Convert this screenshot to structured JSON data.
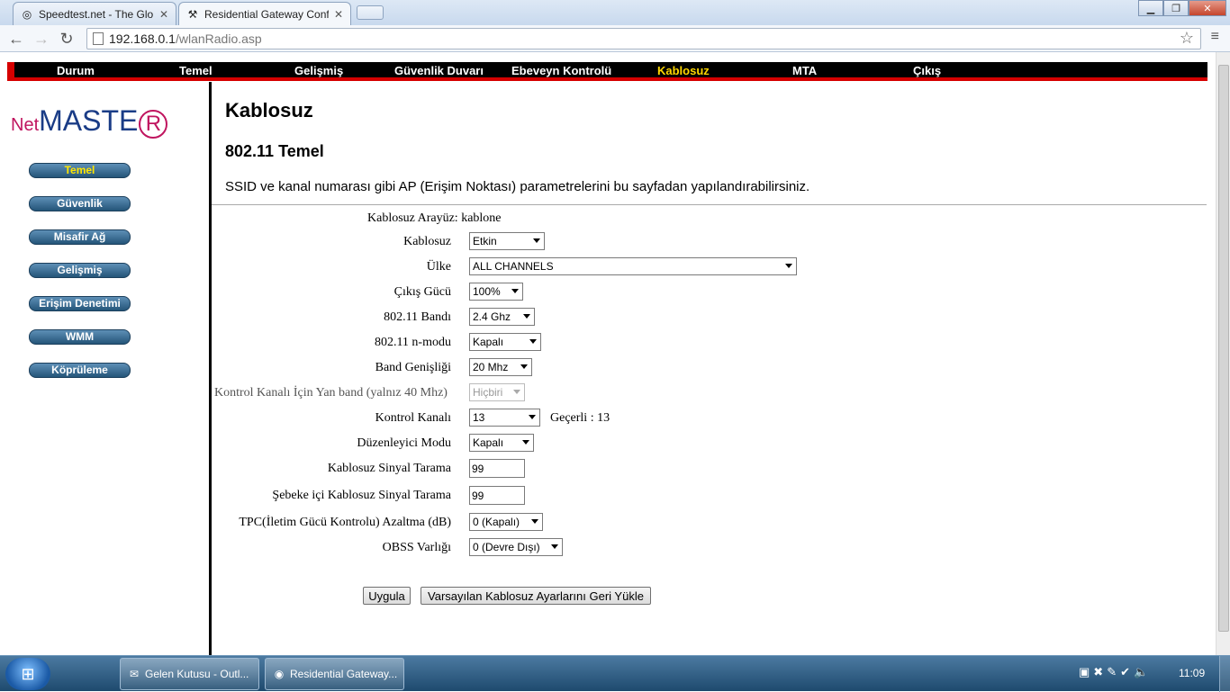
{
  "browser": {
    "tabs": [
      {
        "title": "Speedtest.net - The Global",
        "icon": "speedtest-icon"
      },
      {
        "title": "Residential Gateway Config",
        "icon": "tools-icon"
      }
    ],
    "address": {
      "host": "192.168.0.1",
      "path": "/wlanRadio.asp"
    }
  },
  "topnav": {
    "items": [
      "Durum",
      "Temel",
      "Gelişmiş",
      "Güvenlik Duvarı",
      "Ebeveyn Kontrolü",
      "Kablosuz",
      "MTA",
      "Çıkış"
    ],
    "active": "Kablosuz"
  },
  "logo": {
    "prefix": "Net",
    "main": "MASTE",
    "circled": "R"
  },
  "sidebar": {
    "items": [
      "Temel",
      "Güvenlik",
      "Misafir Ağ",
      "Gelişmiş",
      "Erişim Denetimi",
      "WMM",
      "Köprüleme"
    ],
    "active": "Temel"
  },
  "page": {
    "title": "Kablosuz",
    "section": "802.11 Temel",
    "description": "SSID ve kanal numarası gibi AP (Erişim Noktası) parametrelerini bu sayfadan yapılandırabilirsiniz."
  },
  "form": {
    "interface_label": "Kablosuz Arayüz:",
    "interface_value": "kablone",
    "wireless": {
      "label": "Kablosuz",
      "value": "Etkin"
    },
    "country": {
      "label": "Ülke",
      "value": "ALL CHANNELS"
    },
    "output_power": {
      "label": "Çıkış Gücü",
      "value": "100%"
    },
    "band": {
      "label": "802.11 Bandı",
      "value": "2.4 Ghz"
    },
    "n_mode": {
      "label": "802.11 n-modu",
      "value": "Kapalı"
    },
    "bandwidth": {
      "label": "Band Genişliği",
      "value": "20 Mhz"
    },
    "sideband": {
      "label": "Kontrol Kanalı İçin Yan band (yalnız 40 Mhz)",
      "value": "Hiçbiri"
    },
    "control_channel": {
      "label": "Kontrol Kanalı",
      "value": "13",
      "current": "Geçerli : 13"
    },
    "regulatory_mode": {
      "label": "Düzenleyici Modu",
      "value": "Kapalı"
    },
    "scan": {
      "label": "Kablosuz Sinyal Tarama",
      "value": "99"
    },
    "inband_scan": {
      "label": "Şebeke içi Kablosuz Sinyal Tarama",
      "value": "99"
    },
    "tpc": {
      "label": "TPC(İletim Gücü Kontrolu) Azaltma (dB)",
      "value": "0 (Kapalı)"
    },
    "obss": {
      "label": "OBSS Varlığı",
      "value": "0 (Devre Dışı)"
    },
    "apply_button": "Uygula",
    "restore_button": "Varsayılan Kablosuz Ayarlarını Geri Yükle"
  },
  "taskbar": {
    "items": [
      {
        "title": "Gelen Kutusu - Outl...",
        "icon": "outlook-icon"
      },
      {
        "title": "Residential Gateway...",
        "icon": "chrome-icon"
      }
    ],
    "clock": "11:09"
  }
}
